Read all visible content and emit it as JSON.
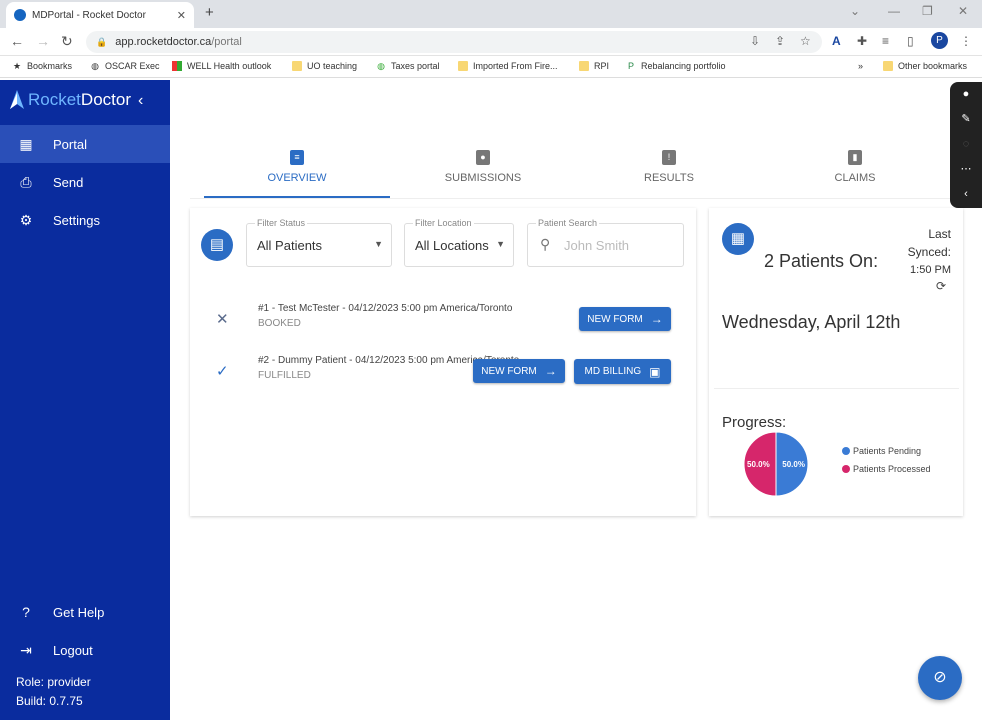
{
  "browser": {
    "tab_title": "MDPortal - Rocket Doctor",
    "url_host": "app.rocketdoctor.ca",
    "url_path": "/portal",
    "profile_initial": "P",
    "bookmarks": [
      "Bookmarks",
      "OSCAR Exec",
      "WELL Health outlook",
      "UO teaching",
      "Taxes portal",
      "Imported From Fire...",
      "RPI",
      "Rebalancing portfolio"
    ],
    "more_bookmarks": "»",
    "other_bookmarks": "Other bookmarks"
  },
  "sidebar": {
    "logo_part1": "Rocket",
    "logo_part2": "Doctor",
    "items": [
      {
        "label": "Portal",
        "icon": "dashboard-icon"
      },
      {
        "label": "Send",
        "icon": "printer-icon"
      },
      {
        "label": "Settings",
        "icon": "settings-icon"
      }
    ],
    "help_label": "Get Help",
    "logout_label": "Logout",
    "role": "Role: provider",
    "build": "Build: 0.7.75"
  },
  "tabs": [
    {
      "label": "OVERVIEW",
      "active": true
    },
    {
      "label": "SUBMISSIONS",
      "active": false
    },
    {
      "label": "RESULTS",
      "active": false
    },
    {
      "label": "CLAIMS",
      "active": false
    }
  ],
  "filters": {
    "status_label": "Filter Status",
    "status_value": "All Patients",
    "location_label": "Filter Location",
    "location_value": "All Locations",
    "search_label": "Patient Search",
    "search_placeholder": "John Smith"
  },
  "appointments": [
    {
      "text": "#1 - Test McTester - 04/12/2023 5:00 pm America/Toronto",
      "status": "BOOKED",
      "icon": "close-icon"
    },
    {
      "text": "#2 - Dummy Patient - 04/12/2023 5:00 pm America/Toronto",
      "status": "FULFILLED",
      "icon": "check-icon"
    }
  ],
  "buttons": {
    "new_form": "NEW FORM",
    "md_billing": "MD BILLING"
  },
  "summary": {
    "patients_on": "2 Patients On:",
    "date": "Wednesday, April 12th",
    "last_synced_1": "Last",
    "last_synced_2": "Synced:",
    "sync_time": "1:50 PM",
    "progress_label": "Progress:"
  },
  "chart_data": {
    "type": "pie",
    "categories": [
      "Patients Pending",
      "Patients Processed"
    ],
    "values": [
      50.0,
      50.0
    ],
    "labels": [
      "50.0%",
      "50.0%"
    ],
    "colors": [
      "#3a7bd5",
      "#d6266b"
    ],
    "legend_position": "right"
  }
}
